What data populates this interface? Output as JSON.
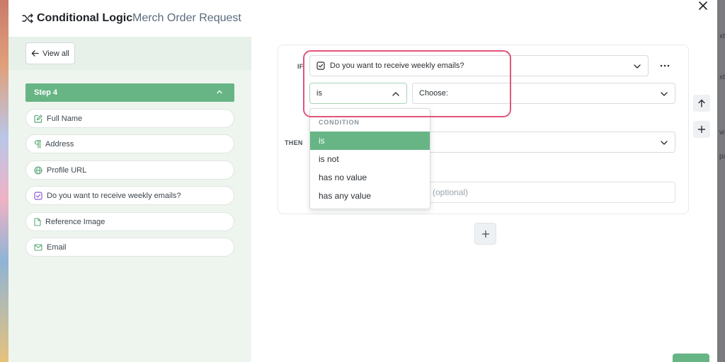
{
  "header": {
    "title": "Conditional Logic",
    "subtitle": "Merch Order Request"
  },
  "sidebar": {
    "view_all_label": "View all",
    "step_label": "Step 4",
    "fields": [
      {
        "label": "Full Name",
        "icon": "edit-icon"
      },
      {
        "label": "Address",
        "icon": "paragraph-icon"
      },
      {
        "label": "Profile URL",
        "icon": "globe-icon"
      },
      {
        "label": "Do you want to receive weekly emails?",
        "icon": "checkbox-icon"
      },
      {
        "label": "Reference Image",
        "icon": "file-icon"
      },
      {
        "label": "Email",
        "icon": "mail-icon"
      }
    ]
  },
  "rule": {
    "if_label": "IF",
    "then_label": "THEN",
    "field_select_value": "Do you want to receive weekly emails?",
    "condition_value": "is",
    "choose_placeholder": "Choose:",
    "optional_placeholder": "(optional)"
  },
  "dropdown": {
    "header": "CONDITION",
    "options": [
      "is",
      "is not",
      "has no value",
      "has any value"
    ],
    "selected": "is"
  },
  "background": {
    "right_texts": [
      "xt",
      "xt",
      "wr",
      "pa"
    ]
  },
  "colors": {
    "accent_green": "#67b585",
    "highlight_pink": "#e2547a"
  }
}
